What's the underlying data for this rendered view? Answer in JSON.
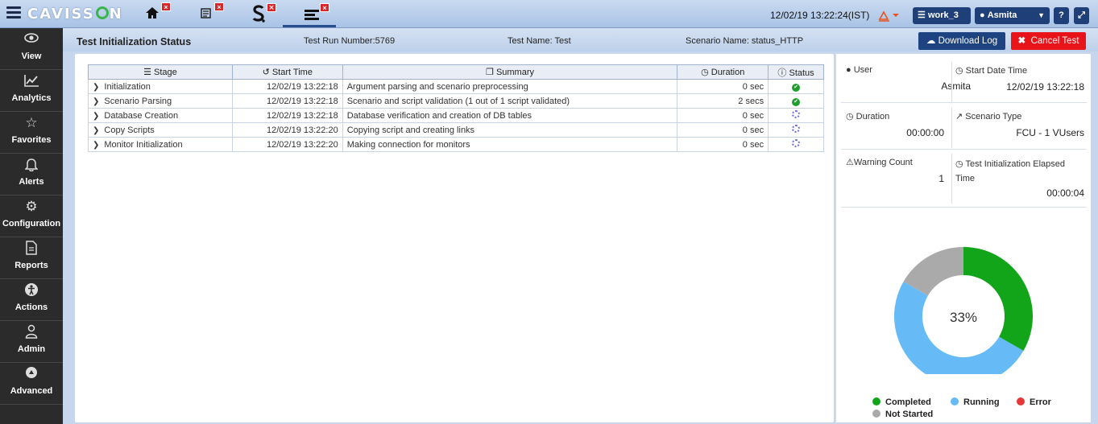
{
  "topbar": {
    "logo_prefix": "CAVISS",
    "logo_suffix": "N",
    "datetime": "12/02/19 13:22:24(IST)",
    "workspace": "work_3",
    "user": "Asmita",
    "help": "?",
    "icons": [
      "home-icon",
      "scenario-icon",
      "script-icon",
      "test-status-icon"
    ]
  },
  "sidebar": {
    "items": [
      {
        "label": "View",
        "icon": "eye-icon"
      },
      {
        "label": "Analytics",
        "icon": "line-chart-icon"
      },
      {
        "label": "Favorites",
        "icon": "star-icon"
      },
      {
        "label": "Alerts",
        "icon": "bell-icon"
      },
      {
        "label": "Configuration",
        "icon": "gears-icon"
      },
      {
        "label": "Reports",
        "icon": "document-icon"
      },
      {
        "label": "Actions",
        "icon": "accessibility-icon"
      },
      {
        "label": "Admin",
        "icon": "user-icon"
      },
      {
        "label": "Advanced",
        "icon": "advanced-icon"
      }
    ]
  },
  "header": {
    "title": "Test Initialization Status",
    "test_run": "Test Run Number:5769",
    "test_name": "Test Name: Test",
    "scenario_name": "Scenario Name: status_HTTP",
    "download_label": "Download Log",
    "cancel_label": "Cancel Test"
  },
  "table": {
    "columns": [
      "Stage",
      "Start Time",
      "Summary",
      "Duration",
      "Status"
    ],
    "rows": [
      {
        "stage": "Initialization",
        "start": "12/02/19 13:22:18",
        "summary": "Argument parsing and scenario preprocessing",
        "duration": "0 sec",
        "status": "completed"
      },
      {
        "stage": "Scenario Parsing",
        "start": "12/02/19 13:22:18",
        "summary": "Scenario and script validation (1 out of 1 script validated)",
        "duration": "2 secs",
        "status": "completed"
      },
      {
        "stage": "Database Creation",
        "start": "12/02/19 13:22:18",
        "summary": "Database verification and creation of DB tables",
        "duration": "0 sec",
        "status": "running"
      },
      {
        "stage": "Copy Scripts",
        "start": "12/02/19 13:22:20",
        "summary": "Copying script and creating links",
        "duration": "0 sec",
        "status": "running"
      },
      {
        "stage": "Monitor Initialization",
        "start": "12/02/19 13:22:20",
        "summary": "Making connection for monitors",
        "duration": "0 sec",
        "status": "running"
      }
    ]
  },
  "info": {
    "user_label": "User",
    "user_value": "Asmita",
    "start_label": "Start Date Time",
    "start_value": "12/02/19 13:22:18",
    "duration_label": "Duration",
    "duration_value": "00:00:00",
    "scenario_type_label": "Scenario Type",
    "scenario_type_value": "FCU - 1 VUsers",
    "warning_label": "Warning Count",
    "warning_value": "1",
    "elapsed_label": "Test Initialization Elapsed Time",
    "elapsed_value": "00:00:04"
  },
  "chart_data": {
    "type": "pie",
    "center_label": "33%",
    "categories": [
      "Completed",
      "Running",
      "Error",
      "Not Started"
    ],
    "values": [
      2,
      3,
      0,
      1
    ],
    "colors": [
      "#12a51a",
      "#66bbf7",
      "#e53939",
      "#aaaaaa"
    ]
  }
}
